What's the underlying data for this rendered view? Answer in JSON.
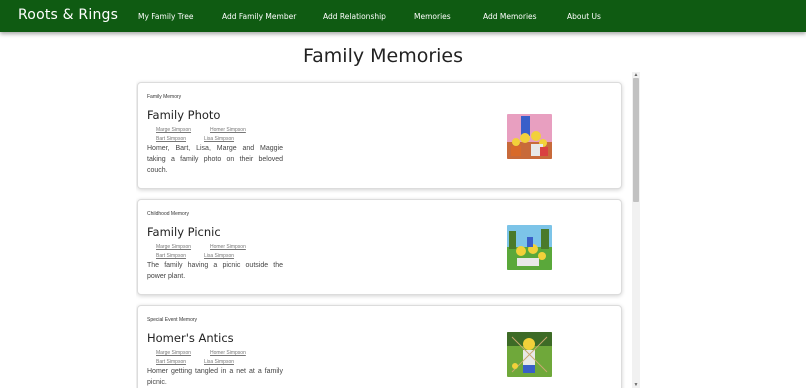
{
  "nav": {
    "brand": "Roots & Rings",
    "links": [
      "My Family Tree",
      "Add Family Member",
      "Add Relationship",
      "Memories",
      "Add Memories",
      "About Us"
    ]
  },
  "page": {
    "title": "Family Memories"
  },
  "memories": [
    {
      "type": "Family Memory",
      "title": "Family Photo",
      "members": [
        "Marge Simpson",
        "Homer Simpson",
        "Bart Simpson",
        "Lisa Simpson"
      ],
      "description": "Homer, Bart, Lisa, Marge and Maggie taking a family photo on their beloved couch.",
      "image": "family-photo-thumbnail"
    },
    {
      "type": "Childhood Memory",
      "title": "Family Picnic",
      "members": [
        "Marge Simpson",
        "Homer Simpson",
        "Bart Simpson",
        "Lisa Simpson"
      ],
      "description": "The family having a picnic outside the power plant.",
      "image": "family-picnic-thumbnail"
    },
    {
      "type": "Special Event Memory",
      "title": "Homer's Antics",
      "members": [
        "Marge Simpson",
        "Homer Simpson",
        "Bart Simpson",
        "Lisa Simpson"
      ],
      "description": "Homer getting tangled in a net at a family picnic.",
      "image": "homers-antics-thumbnail"
    }
  ],
  "colors": {
    "navbar": "#0f5b12",
    "navText": "#ffffff"
  }
}
